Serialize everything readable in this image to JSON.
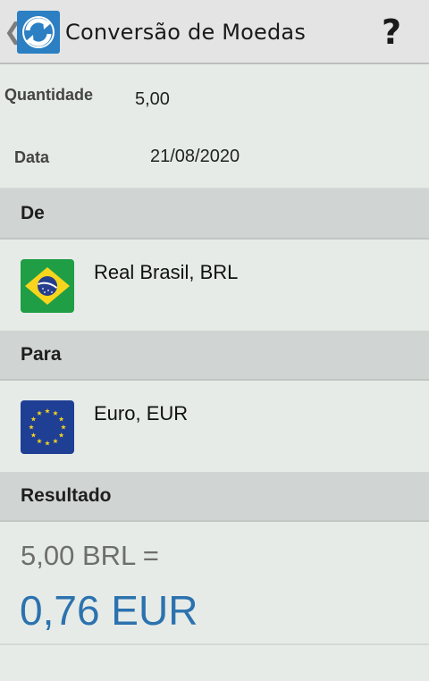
{
  "app_bar": {
    "back_glyph": "❮",
    "title": "Conversão de Moedas",
    "help_glyph": "?",
    "icon": "currency-exchange-icon"
  },
  "form": {
    "quantity_label": "Quantidade",
    "quantity_value": "5,00",
    "date_label": "Data",
    "date_value": "21/08/2020"
  },
  "from_section": {
    "header": "De",
    "currency": "Real Brasil, BRL",
    "flag": "brazil-flag-icon"
  },
  "to_section": {
    "header": "Para",
    "currency": "Euro, EUR",
    "flag": "eu-flag-icon"
  },
  "result_section": {
    "header": "Resultado",
    "from_amount": "5,00 BRL =",
    "to_amount": "0,76 EUR"
  },
  "colors": {
    "background": "#e6ebe8",
    "section_header": "#d0d4d2",
    "result_accent": "#2c72ae",
    "app_icon": "#2b7fc2"
  }
}
